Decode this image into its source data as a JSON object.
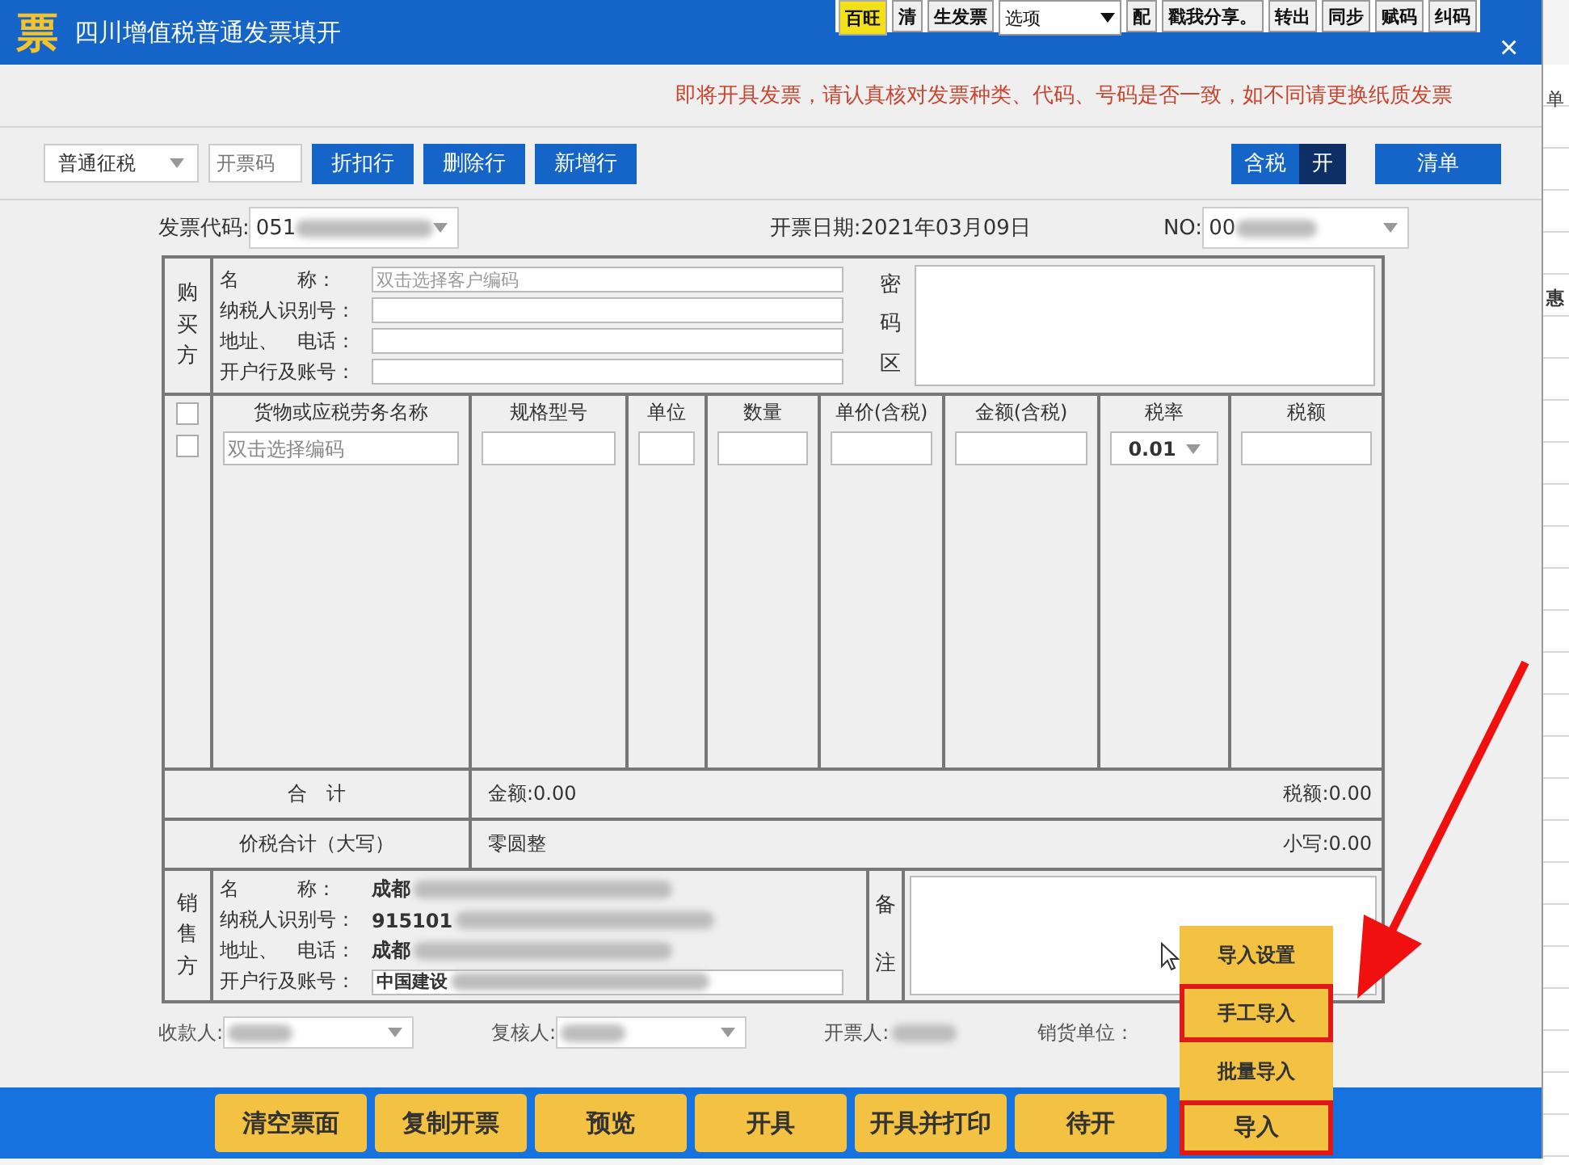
{
  "background_toolbar": [
    {
      "label": "百旺",
      "kind": "highlight"
    },
    {
      "label": "清",
      "kind": "button"
    },
    {
      "label": "生发票",
      "kind": "button"
    },
    {
      "label": "选项",
      "kind": "dropdown"
    },
    {
      "label": "配",
      "kind": "button"
    },
    {
      "label": "戳我分享。",
      "kind": "button"
    },
    {
      "label": "转出",
      "kind": "button"
    },
    {
      "label": "同步",
      "kind": "button"
    },
    {
      "label": "赋码",
      "kind": "button"
    },
    {
      "label": "纠码",
      "kind": "button"
    }
  ],
  "background_sheet": [
    "单",
    "惠"
  ],
  "window": {
    "logo": "票",
    "title": "四川增值税普通发票填开",
    "close": "×"
  },
  "notice": "即将开具发票，请认真核对发票种类、代码、号码是否一致，如不同请更换纸质发票",
  "toolbar": {
    "tax_type": "普通征税",
    "code_placeholder": "开票码",
    "buttons": [
      "折扣行",
      "删除行",
      "新增行"
    ],
    "tax_toggle": {
      "label": "含税",
      "state": "开",
      "on": true
    },
    "list_button": "清单"
  },
  "header": {
    "code_label": "发票代码:",
    "code_value": "051",
    "date": "开票日期:2021年03月09日",
    "no_label": "NO:",
    "no_value": "00"
  },
  "buyer": {
    "section": "购买方",
    "fields": [
      {
        "label": "名　　　称：",
        "placeholder": "双击选择客户编码"
      },
      {
        "label": "纳税人识别号："
      },
      {
        "label": "地址、　电话："
      },
      {
        "label": "开户行及账号："
      }
    ]
  },
  "password_area": "密码区",
  "goods": {
    "columns": [
      "货物或应税劳务名称",
      "规格型号",
      "单位",
      "数量",
      "单价(含税)",
      "金额(含税)",
      "税率",
      "税额"
    ],
    "rows": [
      {
        "checked": false
      },
      {
        "checked": false
      }
    ],
    "name_placeholder": "双击选择编码",
    "tax_rate": "0.01"
  },
  "totals": {
    "label": "合　计",
    "amount": "金额:0.00",
    "tax": "税额:0.00"
  },
  "grand_total": {
    "label": "价税合计（大写）",
    "words": "零圆整",
    "figure": "小写:0.00"
  },
  "seller": {
    "section": "销售方",
    "fields": [
      {
        "label": "名　　　称：",
        "value": "成都",
        "kind": "text"
      },
      {
        "label": "纳税人识别号：",
        "value": "915101",
        "kind": "text"
      },
      {
        "label": "地址、　电话：",
        "value": "成都",
        "kind": "text"
      },
      {
        "label": "开户行及账号：",
        "value": "中国建设",
        "kind": "input"
      }
    ]
  },
  "remarks": "备注",
  "signers": [
    {
      "label": "收款人:",
      "kind": "dropdown"
    },
    {
      "label": "复核人:",
      "kind": "dropdown"
    },
    {
      "label": "开票人:",
      "kind": "text"
    }
  ],
  "seller_unit": "销货单位：",
  "actions": [
    "清空票面",
    "复制开票",
    "预览",
    "开具",
    "开具并打印",
    "待开"
  ],
  "import_menu": {
    "items": [
      {
        "label": "导入设置",
        "highlighted": false
      },
      {
        "label": "手工导入",
        "highlighted": true
      },
      {
        "label": "批量导入",
        "highlighted": false
      }
    ],
    "button": {
      "label": "导入",
      "highlighted": true
    }
  }
}
